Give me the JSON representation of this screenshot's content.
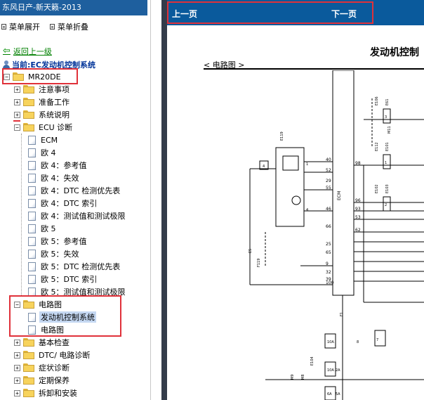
{
  "window_title": "东风日产-新天籁-2013",
  "menu": {
    "expand": "菜单展开",
    "collapse": "菜单折叠"
  },
  "back_link": "返回上一级",
  "current": "当前:EC发动机控制系统",
  "tree": [
    {
      "id": "mr20de",
      "label": "MR20DE",
      "type": "folder",
      "expander": "−",
      "level": 0
    },
    {
      "id": "notes",
      "label": "注意事项",
      "type": "folder",
      "expander": "+",
      "level": 1
    },
    {
      "id": "prep",
      "label": "准备工作",
      "type": "folder",
      "expander": "+",
      "level": 1
    },
    {
      "id": "sysdesc",
      "label": "系统说明",
      "type": "folder",
      "expander": "+",
      "level": 1
    },
    {
      "id": "ecu",
      "label": "ECU 诊断",
      "type": "folder",
      "expander": "−",
      "level": 1
    },
    {
      "id": "ecm",
      "label": "ECM",
      "type": "doc",
      "level": 2
    },
    {
      "id": "eu4",
      "label": "欧 4",
      "type": "doc",
      "level": 2
    },
    {
      "id": "eu4ref",
      "label": "欧 4：参考值",
      "type": "doc",
      "level": 2
    },
    {
      "id": "eu4fail",
      "label": "欧 4：失效",
      "type": "doc",
      "level": 2
    },
    {
      "id": "eu4dtcp",
      "label": "欧 4：DTC 检测优先表",
      "type": "doc",
      "level": 2
    },
    {
      "id": "eu4dtci",
      "label": "欧 4：DTC 索引",
      "type": "doc",
      "level": 2
    },
    {
      "id": "eu4test",
      "label": "欧 4：测试值和测试极限",
      "type": "doc",
      "level": 2
    },
    {
      "id": "eu5",
      "label": "欧 5",
      "type": "doc",
      "level": 2
    },
    {
      "id": "eu5ref",
      "label": "欧 5：参考值",
      "type": "doc",
      "level": 2
    },
    {
      "id": "eu5fail",
      "label": "欧 5：失效",
      "type": "doc",
      "level": 2
    },
    {
      "id": "eu5dtcp",
      "label": "欧 5：DTC 检测优先表",
      "type": "doc",
      "level": 2
    },
    {
      "id": "eu5dtci",
      "label": "欧 5：DTC 索引",
      "type": "doc",
      "level": 2
    },
    {
      "id": "eu5test",
      "label": "欧 5：测试值和测试极限",
      "type": "doc",
      "level": 2
    },
    {
      "id": "circuit",
      "label": "电路图",
      "type": "folder",
      "expander": "−",
      "level": 1
    },
    {
      "id": "ecsys",
      "label": "发动机控制系统",
      "type": "doc",
      "level": 2,
      "selected": true
    },
    {
      "id": "circuitdoc",
      "label": "电路图",
      "type": "doc",
      "level": 2
    },
    {
      "id": "basic",
      "label": "基本检查",
      "type": "folder",
      "expander": "+",
      "level": 1
    },
    {
      "id": "dtcdiag",
      "label": "DTC/ 电路诊断",
      "type": "folder",
      "expander": "+",
      "level": 1
    },
    {
      "id": "symptom",
      "label": "症状诊断",
      "type": "folder",
      "expander": "+",
      "level": 1
    },
    {
      "id": "maint",
      "label": "定期保养",
      "type": "folder",
      "expander": "+",
      "level": 1
    },
    {
      "id": "removal",
      "label": "拆卸和安装",
      "type": "folder",
      "expander": "+",
      "level": 1
    }
  ],
  "nav": {
    "prev": "上一页",
    "next": "下一页"
  },
  "doc": {
    "title": "发动机控制",
    "subtitle": "< 电路图 >"
  },
  "diagram": {
    "ecm_label": "ECM",
    "pins": [
      "40",
      "52",
      "29",
      "55",
      "46",
      "66",
      "25",
      "65",
      "9",
      "32",
      "39",
      "100"
    ],
    "right_pins": [
      "98",
      "96",
      "93",
      "53",
      "62"
    ],
    "connectors": [
      "E106",
      "E61",
      "E112",
      "E101",
      "E102",
      "E103",
      "E104",
      "M8",
      "M9",
      "E5",
      "F119",
      "F1",
      "E119",
      "M11"
    ],
    "small_labels": [
      "3",
      "1",
      "2",
      "4",
      "10A",
      "10A",
      "6A",
      "5A",
      "2A",
      "7",
      "8",
      "1",
      "4"
    ]
  },
  "colors": {
    "titlebar": "#1e5f9e",
    "navbar": "#0a5a9c",
    "highlight_box": "#e0313a",
    "selection": "#c5d8f2"
  }
}
